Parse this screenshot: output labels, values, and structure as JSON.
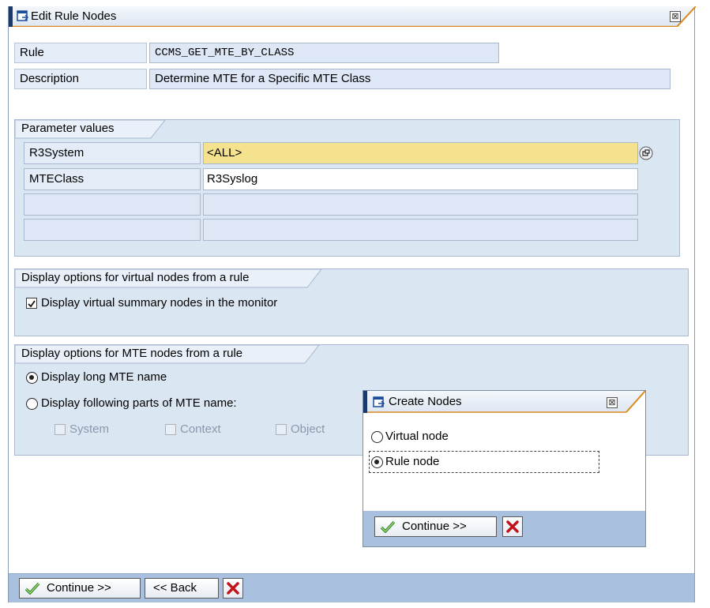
{
  "window": {
    "title": "Edit Rule Nodes",
    "close_glyph": "⊠"
  },
  "rule": {
    "label": "Rule",
    "value": "CCMS_GET_MTE_BY_CLASS"
  },
  "description": {
    "label": "Description",
    "value": "Determine MTE for a Specific MTE Class"
  },
  "parameters": {
    "title": "Parameter values",
    "rows": [
      {
        "name": "R3System",
        "value": "<ALL>"
      },
      {
        "name": "MTEClass",
        "value": "R3Syslog"
      }
    ]
  },
  "virtual_options": {
    "title": "Display options for virtual nodes from a rule",
    "checkbox_label": "Display virtual summary nodes in the monitor",
    "checked": true
  },
  "mte_options": {
    "title": "Display options for MTE nodes from a rule",
    "radio_long": "Display long MTE name",
    "radio_parts": "Display following parts of MTE name:",
    "selected": "long",
    "parts": [
      "System",
      "Context",
      "Object"
    ]
  },
  "footer": {
    "continue_label": "Continue >>",
    "back_label": "<< Back"
  },
  "popup": {
    "title": "Create Nodes",
    "options": [
      "Virtual node",
      "Rule node"
    ],
    "selected": "Rule node",
    "continue_label": "Continue >>"
  },
  "colors": {
    "titlebar_accent": "#1a3a6e",
    "panel_bg": "#dbe6f3",
    "footer_bg": "#a9c1de",
    "highlight_field": "#f5e28e",
    "continue_check": "#2f8a1e",
    "cancel_x": "#c0141a"
  },
  "icons": {
    "window": "dialog-icon",
    "close": "close-icon",
    "f4_help": "value-help-icon",
    "ok": "checkmark-icon",
    "cancel": "cancel-x-icon"
  }
}
